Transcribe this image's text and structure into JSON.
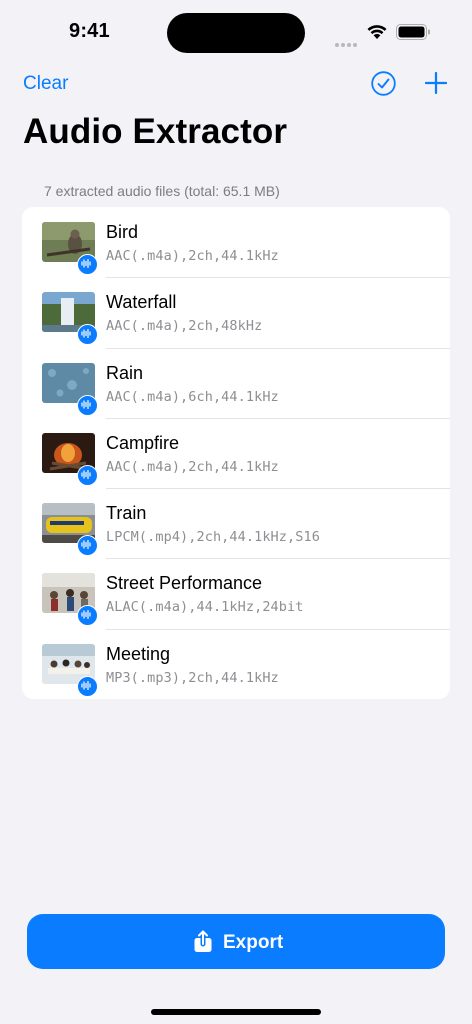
{
  "status_bar": {
    "time": "9:41"
  },
  "nav": {
    "clear_label": "Clear",
    "select_icon": "checkmark-circle-icon",
    "add_icon": "plus-icon"
  },
  "page": {
    "title": "Audio Extractor"
  },
  "list": {
    "header": "7 extracted audio files (total: 65.1 MB)",
    "items": [
      {
        "title": "Bird",
        "meta": "AAC(.m4a),2ch,44.1kHz",
        "badge_icon": "waveform-icon"
      },
      {
        "title": "Waterfall",
        "meta": "AAC(.m4a),2ch,48kHz",
        "badge_icon": "waveform-icon"
      },
      {
        "title": "Rain",
        "meta": "AAC(.m4a),6ch,44.1kHz",
        "badge_icon": "waveform-icon"
      },
      {
        "title": "Campfire",
        "meta": "AAC(.m4a),2ch,44.1kHz",
        "badge_icon": "waveform-icon"
      },
      {
        "title": "Train",
        "meta": "LPCM(.mp4),2ch,44.1kHz,S16",
        "badge_icon": "waveform-icon"
      },
      {
        "title": "Street Performance",
        "meta": "ALAC(.m4a),44.1kHz,24bit",
        "badge_icon": "waveform-icon"
      },
      {
        "title": "Meeting",
        "meta": "MP3(.mp3),2ch,44.1kHz",
        "badge_icon": "waveform-icon"
      }
    ]
  },
  "export": {
    "label": "Export",
    "icon": "share-icon"
  },
  "colors": {
    "accent": "#0a7cff",
    "background": "#f2f2f7",
    "secondary_text": "#8e8e93"
  }
}
